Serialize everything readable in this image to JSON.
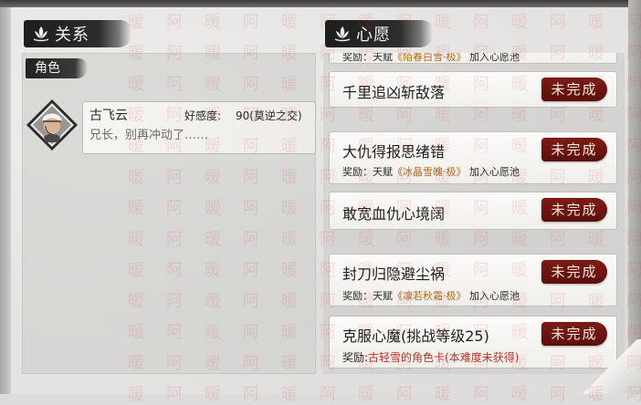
{
  "left": {
    "header": "关系",
    "role_tag": "角色",
    "character": {
      "name": "古飞云",
      "favor_label": "好感度:",
      "favor_value": "90(莫逆之交)",
      "quote": "兄长，别再冲动了……"
    }
  },
  "right": {
    "header": "心愿",
    "partial_reward": {
      "prefix": "奖励：天赋",
      "item": "《陌春白雪·极》",
      "suffix": "加入心愿池"
    },
    "wishes": [
      {
        "title": "千里追凶斩敌落",
        "status": "未完成"
      },
      {
        "title": "大仇得报思绪错",
        "status": "未完成",
        "reward_prefix": "奖励：天赋",
        "reward_item": "《冰晶雪魄·极》",
        "reward_suffix": "加入心愿池"
      },
      {
        "title": "敢宽血仇心境阔",
        "status": "未完成"
      },
      {
        "title": "封刀归隐避尘祸",
        "status": "未完成",
        "reward_prefix": "奖励：天赋",
        "reward_item": "《凛若秋霜·极》",
        "reward_suffix": "加入心愿池"
      },
      {
        "title": "克服心魔(挑战等级25)",
        "status": "未完成",
        "reward_prefix": "奖励:",
        "reward_item": "古轻雪的角色卡(本难度未获得)"
      }
    ]
  },
  "watermark": {
    "chars": [
      "暖",
      "阿"
    ],
    "color": "#d22828"
  },
  "colors": {
    "status_button": "#6a1510",
    "reward_gold": "#b06a1d",
    "reward_red": "#b8352a",
    "header_ink": "#222222"
  }
}
